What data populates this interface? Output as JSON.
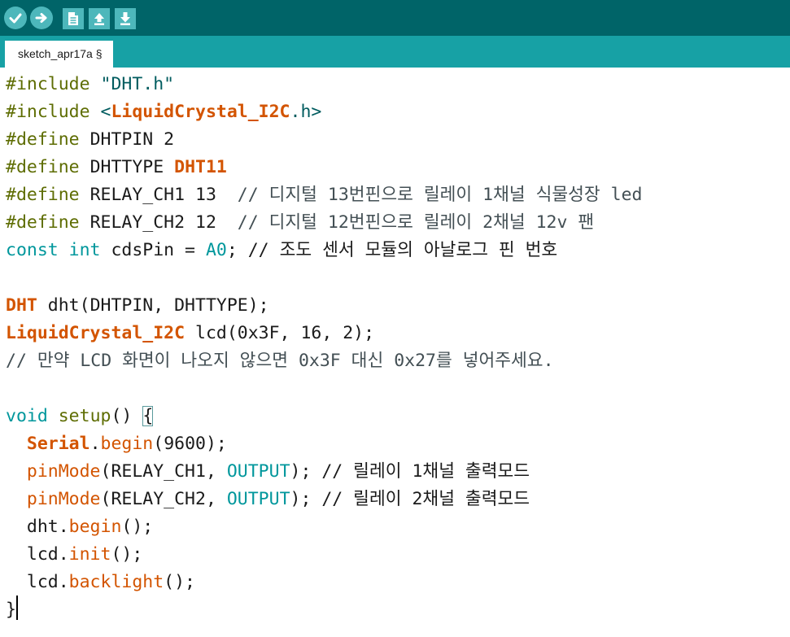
{
  "toolbar": {
    "buttons": [
      {
        "name": "verify-button",
        "icon": "check-icon"
      },
      {
        "name": "upload-button",
        "icon": "arrow-right-icon"
      },
      {
        "name": "new-button",
        "icon": "new-file-icon"
      },
      {
        "name": "open-button",
        "icon": "arrow-up-icon"
      },
      {
        "name": "save-button",
        "icon": "arrow-down-icon"
      }
    ],
    "colors": {
      "bar": "#006468",
      "button": "#4db7bb",
      "tabbar": "#17a1a5"
    }
  },
  "tab": {
    "label": "sketch_apr17a §"
  },
  "editor": {
    "lines": [
      [
        {
          "t": "#include ",
          "c": "t-dir"
        },
        {
          "t": "\"DHT.h\"",
          "c": "t-str"
        }
      ],
      [
        {
          "t": "#include ",
          "c": "t-dir"
        },
        {
          "t": "<",
          "c": "t-str"
        },
        {
          "t": "LiquidCrystal_I2C",
          "c": "t-bold"
        },
        {
          "t": ".h>",
          "c": "t-str"
        }
      ],
      [
        {
          "t": "#define ",
          "c": "t-dir"
        },
        {
          "t": "DHTPIN 2",
          "c": "t-plain"
        }
      ],
      [
        {
          "t": "#define ",
          "c": "t-dir"
        },
        {
          "t": "DHTTYPE ",
          "c": "t-plain"
        },
        {
          "t": "DHT11",
          "c": "t-bold"
        }
      ],
      [
        {
          "t": "#define ",
          "c": "t-dir"
        },
        {
          "t": "RELAY_CH1 13  ",
          "c": "t-plain"
        },
        {
          "t": "// 디지털 13번핀으로 릴레이 1채널 식물성장 led",
          "c": "t-cmt"
        }
      ],
      [
        {
          "t": "#define ",
          "c": "t-dir"
        },
        {
          "t": "RELAY_CH2 12  ",
          "c": "t-plain"
        },
        {
          "t": "// 디지털 12번핀으로 릴레이 2채널 12v 팬",
          "c": "t-cmt"
        }
      ],
      [
        {
          "t": "const int ",
          "c": "t-kw"
        },
        {
          "t": "cdsPin = ",
          "c": "t-plain"
        },
        {
          "t": "A0",
          "c": "t-kw"
        },
        {
          "t": "; // 조도 센서 모듈의 아날로그 핀 번호",
          "c": "t-plain"
        }
      ],
      [
        {
          "t": "",
          "c": "t-plain"
        }
      ],
      [
        {
          "t": "DHT",
          "c": "t-bold"
        },
        {
          "t": " dht(DHTPIN, DHTTYPE);",
          "c": "t-plain"
        }
      ],
      [
        {
          "t": "LiquidCrystal_I2C",
          "c": "t-bold"
        },
        {
          "t": " lcd(0x3F, 16, 2);",
          "c": "t-plain"
        }
      ],
      [
        {
          "t": "// 만약 LCD 화면이 나오지 않으면 0x3F 대신 0x27를 넣어주세요.",
          "c": "t-cmt"
        }
      ],
      [
        {
          "t": "",
          "c": "t-plain"
        }
      ],
      [
        {
          "t": "void ",
          "c": "t-kw"
        },
        {
          "t": "setup",
          "c": "t-dir"
        },
        {
          "t": "() ",
          "c": "t-plain"
        },
        {
          "t": "{",
          "c": "t-plain t-brace"
        }
      ],
      [
        {
          "t": "  ",
          "c": "t-plain"
        },
        {
          "t": "Serial",
          "c": "t-bold"
        },
        {
          "t": ".",
          "c": "t-plain"
        },
        {
          "t": "begin",
          "c": "t-fn"
        },
        {
          "t": "(9600);",
          "c": "t-plain"
        }
      ],
      [
        {
          "t": "  ",
          "c": "t-plain"
        },
        {
          "t": "pinMode",
          "c": "t-fn"
        },
        {
          "t": "(RELAY_CH1, ",
          "c": "t-plain"
        },
        {
          "t": "OUTPUT",
          "c": "t-kw"
        },
        {
          "t": "); // 릴레이 1채널 출력모드",
          "c": "t-plain"
        }
      ],
      [
        {
          "t": "  ",
          "c": "t-plain"
        },
        {
          "t": "pinMode",
          "c": "t-fn"
        },
        {
          "t": "(RELAY_CH2, ",
          "c": "t-plain"
        },
        {
          "t": "OUTPUT",
          "c": "t-kw"
        },
        {
          "t": "); // 릴레이 2채널 출력모드",
          "c": "t-plain"
        }
      ],
      [
        {
          "t": "  dht.",
          "c": "t-plain"
        },
        {
          "t": "begin",
          "c": "t-fn"
        },
        {
          "t": "();",
          "c": "t-plain"
        }
      ],
      [
        {
          "t": "  lcd.",
          "c": "t-plain"
        },
        {
          "t": "init",
          "c": "t-fn"
        },
        {
          "t": "();",
          "c": "t-plain"
        }
      ],
      [
        {
          "t": "  lcd.",
          "c": "t-plain"
        },
        {
          "t": "backlight",
          "c": "t-fn"
        },
        {
          "t": "();",
          "c": "t-plain"
        }
      ],
      [
        {
          "t": "}",
          "c": "t-plain"
        }
      ]
    ]
  }
}
